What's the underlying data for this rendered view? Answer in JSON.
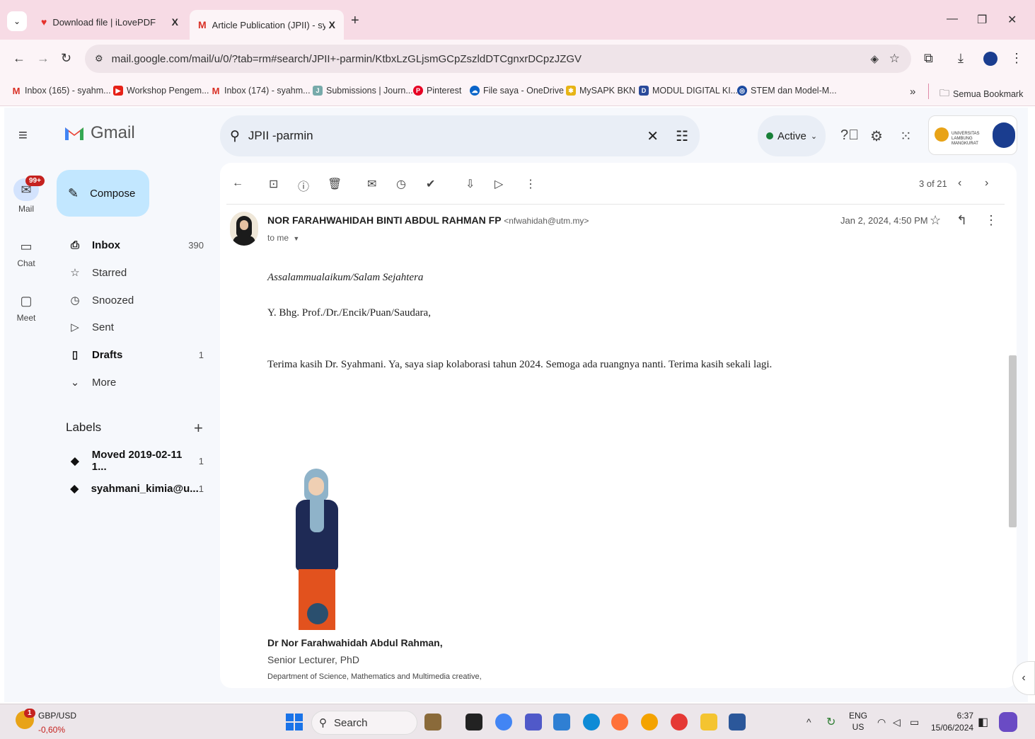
{
  "browser": {
    "tabs": [
      {
        "label": "Download file | iLovePDF",
        "close": "X"
      },
      {
        "label": "Article Publication (JPII) - syahm",
        "close": "X"
      }
    ],
    "new_tab": "+",
    "url": "mail.google.com/mail/u/0/?tab=rm#search/JPII+-parmin/KtbxLzGLjsmGCpZszldDTCgnxrDCpzJZGV",
    "bookmarks": [
      "Inbox (165) - syahm...",
      "Workshop Pengem...",
      "Inbox (174) - syahm...",
      "Submissions | Journ...",
      "Pinterest",
      "File saya - OneDrive",
      "MySAPK BKN",
      "MODUL DIGITAL KI...",
      "STEM dan Model-M..."
    ],
    "bookmarks_more": "»",
    "all_bookmarks": "Semua Bookmark"
  },
  "gmail": {
    "logo_text": "Gmail",
    "rail": {
      "mail": "Mail",
      "mail_badge": "99+",
      "chat": "Chat",
      "meet": "Meet"
    },
    "compose": "Compose",
    "nav": [
      {
        "label": "Inbox",
        "count": "390"
      },
      {
        "label": "Starred",
        "count": ""
      },
      {
        "label": "Snoozed",
        "count": ""
      },
      {
        "label": "Sent",
        "count": ""
      },
      {
        "label": "Drafts",
        "count": "1"
      },
      {
        "label": "More",
        "count": ""
      }
    ],
    "labels_heading": "Labels",
    "labels": [
      {
        "label": "Moved 2019-02-11 1...",
        "count": "1"
      },
      {
        "label": "syahmani_kimia@u...",
        "count": "1"
      }
    ],
    "search_value": "JPII -parmin",
    "status": "Active",
    "pagination": "3 of 21",
    "account_logo_text": "UNIVERSITAS LAMBUNG MANGKURAT"
  },
  "email": {
    "sender_name": "NOR FARAHWAHIDAH BINTI ABDUL RAHMAN FP",
    "sender_email": "<nfwahidah@utm.my>",
    "to": "to me",
    "date": "Jan 2, 2024, 4:50 PM",
    "greeting": "Assalammualaikum/Salam Sejahtera",
    "salutation": "Y. Bhg. Prof./Dr./Encik/Puan/Saudara,",
    "body": "Terima kasih Dr. Syahmani. Ya, saya siap kolaborasi tahun 2024. Semoga ada ruangnya nanti. Terima kasih sekali lagi.",
    "sig_name": "Dr Nor Farahwahidah Abdul Rahman,",
    "sig_title": "Senior Lecturer, PhD",
    "sig_dept": "Department of Science, Mathematics and Multimedia creative,"
  },
  "taskbar": {
    "widget_badge": "1",
    "widget_title": "GBP/USD",
    "widget_value": "-0,60%",
    "search": "Search",
    "lang_top": "ENG",
    "lang_bottom": "US",
    "time": "6:37",
    "date": "15/06/2024"
  }
}
